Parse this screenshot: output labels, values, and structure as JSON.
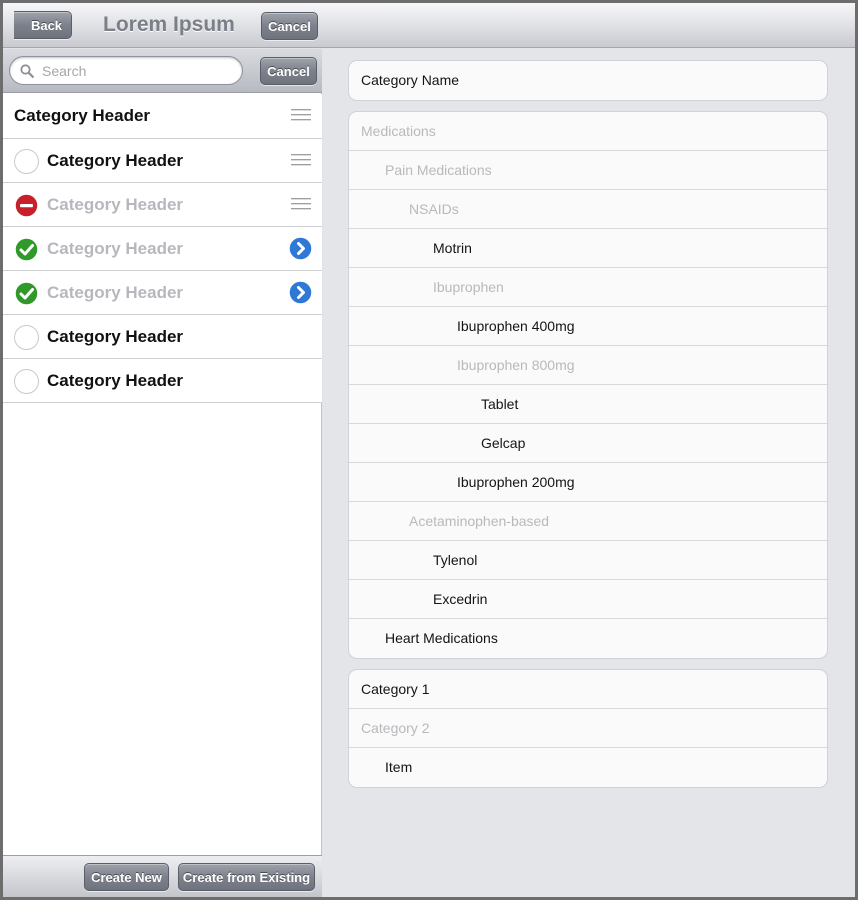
{
  "nav": {
    "back_label": "Back",
    "title": "Lorem Ipsum",
    "cancel_label": "Cancel"
  },
  "search": {
    "placeholder": "Search",
    "value": "",
    "cancel_label": "Cancel"
  },
  "list": {
    "items": [
      {
        "label": "Category Header",
        "state": "header",
        "dim": false,
        "accessory": "reorder-icon"
      },
      {
        "label": "Category Header",
        "state": "unselected",
        "dim": false,
        "accessory": "reorder-icon"
      },
      {
        "label": "Category Header",
        "state": "delete",
        "dim": true,
        "accessory": "reorder-icon"
      },
      {
        "label": "Category Header",
        "state": "checked",
        "dim": true,
        "accessory": "disclosure-icon"
      },
      {
        "label": "Category Header",
        "state": "checked",
        "dim": true,
        "accessory": "disclosure-icon"
      },
      {
        "label": "Category Header",
        "state": "unselected",
        "dim": false,
        "accessory": ""
      },
      {
        "label": "Category Header",
        "state": "unselected",
        "dim": false,
        "accessory": ""
      }
    ]
  },
  "toolbar": {
    "create_new_label": "Create New",
    "create_existing_label": "Create from Existing"
  },
  "detail": {
    "category_name": "Category Name",
    "tree": [
      {
        "label": "Medications",
        "level": 0,
        "dim": true
      },
      {
        "label": "Pain Medications",
        "level": 1,
        "dim": true
      },
      {
        "label": "NSAIDs",
        "level": 2,
        "dim": true
      },
      {
        "label": "Motrin",
        "level": 3,
        "dim": false
      },
      {
        "label": "Ibuprophen",
        "level": 3,
        "dim": true
      },
      {
        "label": "Ibuprophen 400mg",
        "level": 4,
        "dim": false
      },
      {
        "label": "Ibuprophen 800mg",
        "level": 4,
        "dim": true
      },
      {
        "label": "Tablet",
        "level": 5,
        "dim": false
      },
      {
        "label": "Gelcap",
        "level": 5,
        "dim": false
      },
      {
        "label": "Ibuprophen 200mg",
        "level": 4,
        "dim": false
      },
      {
        "label": "Acetaminophen-based",
        "level": 2,
        "dim": true
      },
      {
        "label": "Tylenol",
        "level": 3,
        "dim": false
      },
      {
        "label": "Excedrin",
        "level": 3,
        "dim": false
      },
      {
        "label": "Heart Medications",
        "level": 1,
        "dim": false
      }
    ],
    "categories": [
      {
        "label": "Category 1",
        "level": 0,
        "dim": false
      },
      {
        "label": "Category 2",
        "level": 0,
        "dim": true
      },
      {
        "label": "Item",
        "level": 1,
        "dim": false
      }
    ]
  },
  "colors": {
    "delete_red": "#c8202a",
    "check_green": "#2f9a2a",
    "disclosure_blue": "#2f78d6"
  }
}
